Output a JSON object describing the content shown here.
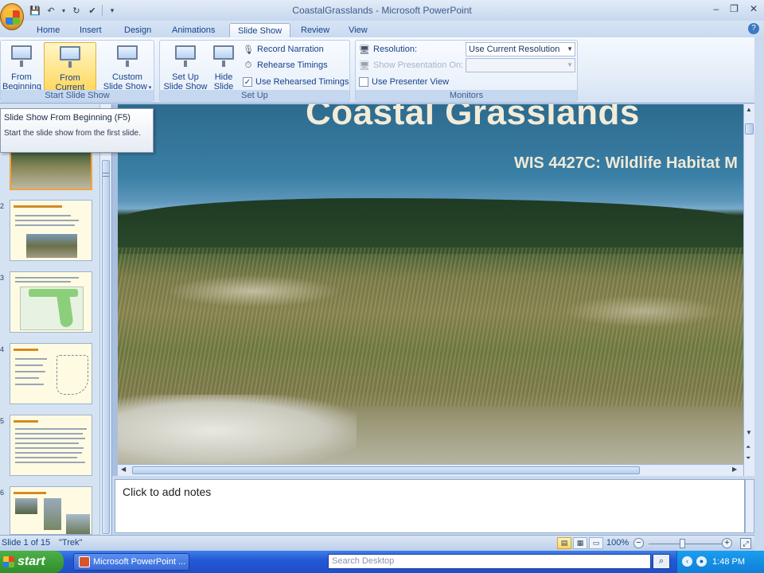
{
  "window": {
    "title": "CoastalGrasslands - Microsoft PowerPoint"
  },
  "tabs": [
    {
      "label": "Home"
    },
    {
      "label": "Insert"
    },
    {
      "label": "Design"
    },
    {
      "label": "Animations"
    },
    {
      "label": "Slide Show",
      "active": true
    },
    {
      "label": "Review"
    },
    {
      "label": "View"
    }
  ],
  "ribbon": {
    "start_group": {
      "label": "Start Slide Show",
      "from_beginning_l1": "From",
      "from_beginning_l2": "Beginning",
      "from_current_l1": "From",
      "from_current_l2": "Current Slide",
      "custom_l1": "Custom",
      "custom_l2": "Slide Show"
    },
    "setup_group": {
      "label": "Set Up",
      "setup_l1": "Set Up",
      "setup_l2": "Slide Show",
      "hide_l1": "Hide",
      "hide_l2": "Slide",
      "record_narration": "Record Narration",
      "rehearse_timings": "Rehearse Timings",
      "use_rehearsed_timings": "Use Rehearsed Timings",
      "use_rehearsed_checked": true
    },
    "monitors_group": {
      "label": "Monitors",
      "resolution_label": "Resolution:",
      "resolution_value": "Use Current Resolution",
      "show_on_label": "Show Presentation On:",
      "show_on_value": "",
      "presenter_view": "Use Presenter View",
      "presenter_view_checked": false
    }
  },
  "tooltip": {
    "title": "Slide Show From Beginning (F5)",
    "body": "Start the slide show from the first slide."
  },
  "thumbnails": [
    {
      "num": "1",
      "selected": true
    },
    {
      "num": "2"
    },
    {
      "num": "3"
    },
    {
      "num": "4"
    },
    {
      "num": "5"
    },
    {
      "num": "6"
    }
  ],
  "slide": {
    "title": "Coastal Grasslands",
    "subtitle": "WIS 4427C: Wildlife Habitat M"
  },
  "notes": {
    "placeholder": "Click to add notes"
  },
  "status": {
    "slide_counter": "Slide 1 of 15",
    "theme": "\"Trek\"",
    "zoom": "100%",
    "zoom_level_percent": 100
  },
  "taskbar": {
    "start_label": "start",
    "task_label": "Microsoft PowerPoint ...",
    "search_placeholder": "Search Desktop",
    "clock": "1:48 PM"
  },
  "colors": {
    "ribbon_bg": "#dfe9f5",
    "accent_highlight": "#ffd85e",
    "taskbar_blue": "#2459d6",
    "start_green": "#3a9e35"
  }
}
